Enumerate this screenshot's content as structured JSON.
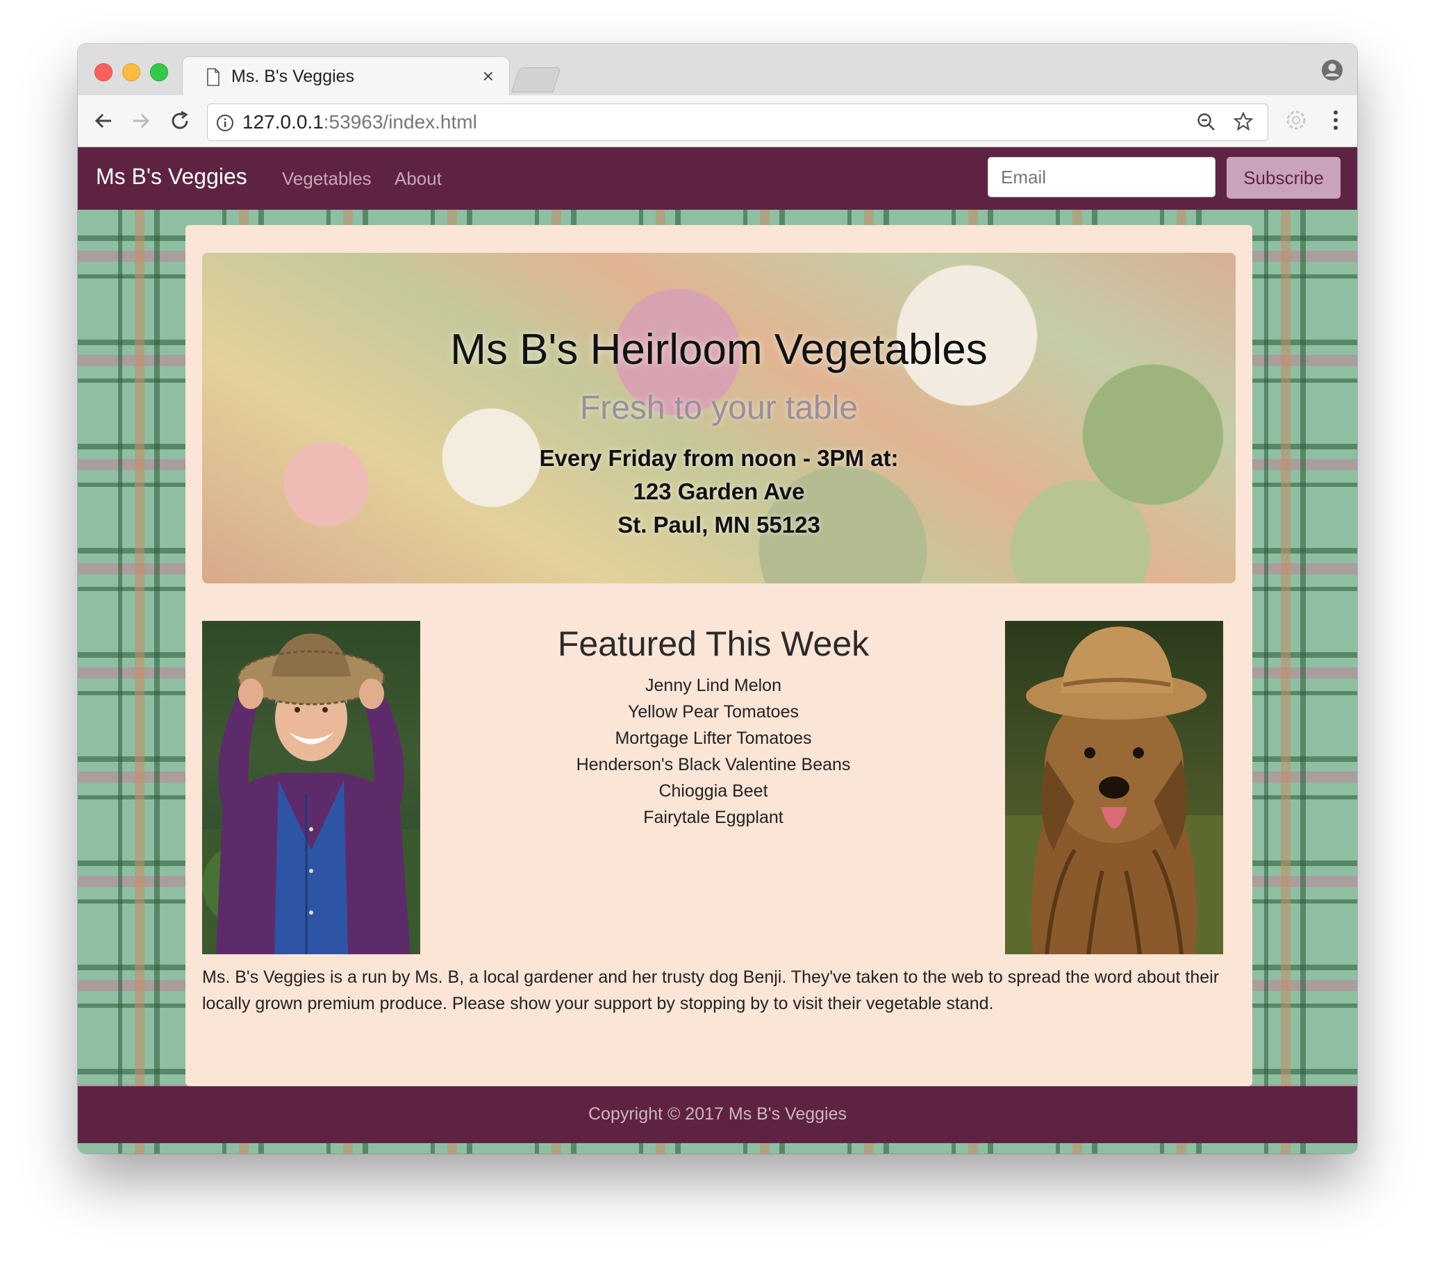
{
  "browser": {
    "tab_title": "Ms. B's Veggies",
    "tab_close": "×",
    "url_host": "127.0.0.1",
    "url_rest": ":53963/index.html"
  },
  "navbar": {
    "brand": "Ms B's Veggies",
    "links": [
      "Vegetables",
      "About"
    ],
    "email_placeholder": "Email",
    "subscribe_label": "Subscribe"
  },
  "hero": {
    "title": "Ms B's Heirloom Vegetables",
    "subtitle": "Fresh to your table",
    "schedule": "Every Friday from noon - 3PM at:",
    "address_line1": "123 Garden Ave",
    "address_line2": "St. Paul, MN 55123"
  },
  "featured": {
    "heading": "Featured This Week",
    "items": [
      "Jenny Lind Melon",
      "Yellow Pear Tomatoes",
      "Mortgage Lifter Tomatoes",
      "Henderson's Black Valentine Beans",
      "Chioggia Beet",
      "Fairytale Eggplant"
    ]
  },
  "about_text": "Ms. B's Veggies is a run by Ms. B, a local gardener and her trusty dog Benji. They've taken to the web to spread the word about their locally grown premium produce. Please show your support by stopping by to visit their vegetable stand.",
  "footer": {
    "copyright": "Copyright © 2017 Ms B's Veggies"
  },
  "colors": {
    "brand": "#5e2343",
    "content_bg": "#fae5d6",
    "subscribe_bg": "#c9a3bb"
  }
}
